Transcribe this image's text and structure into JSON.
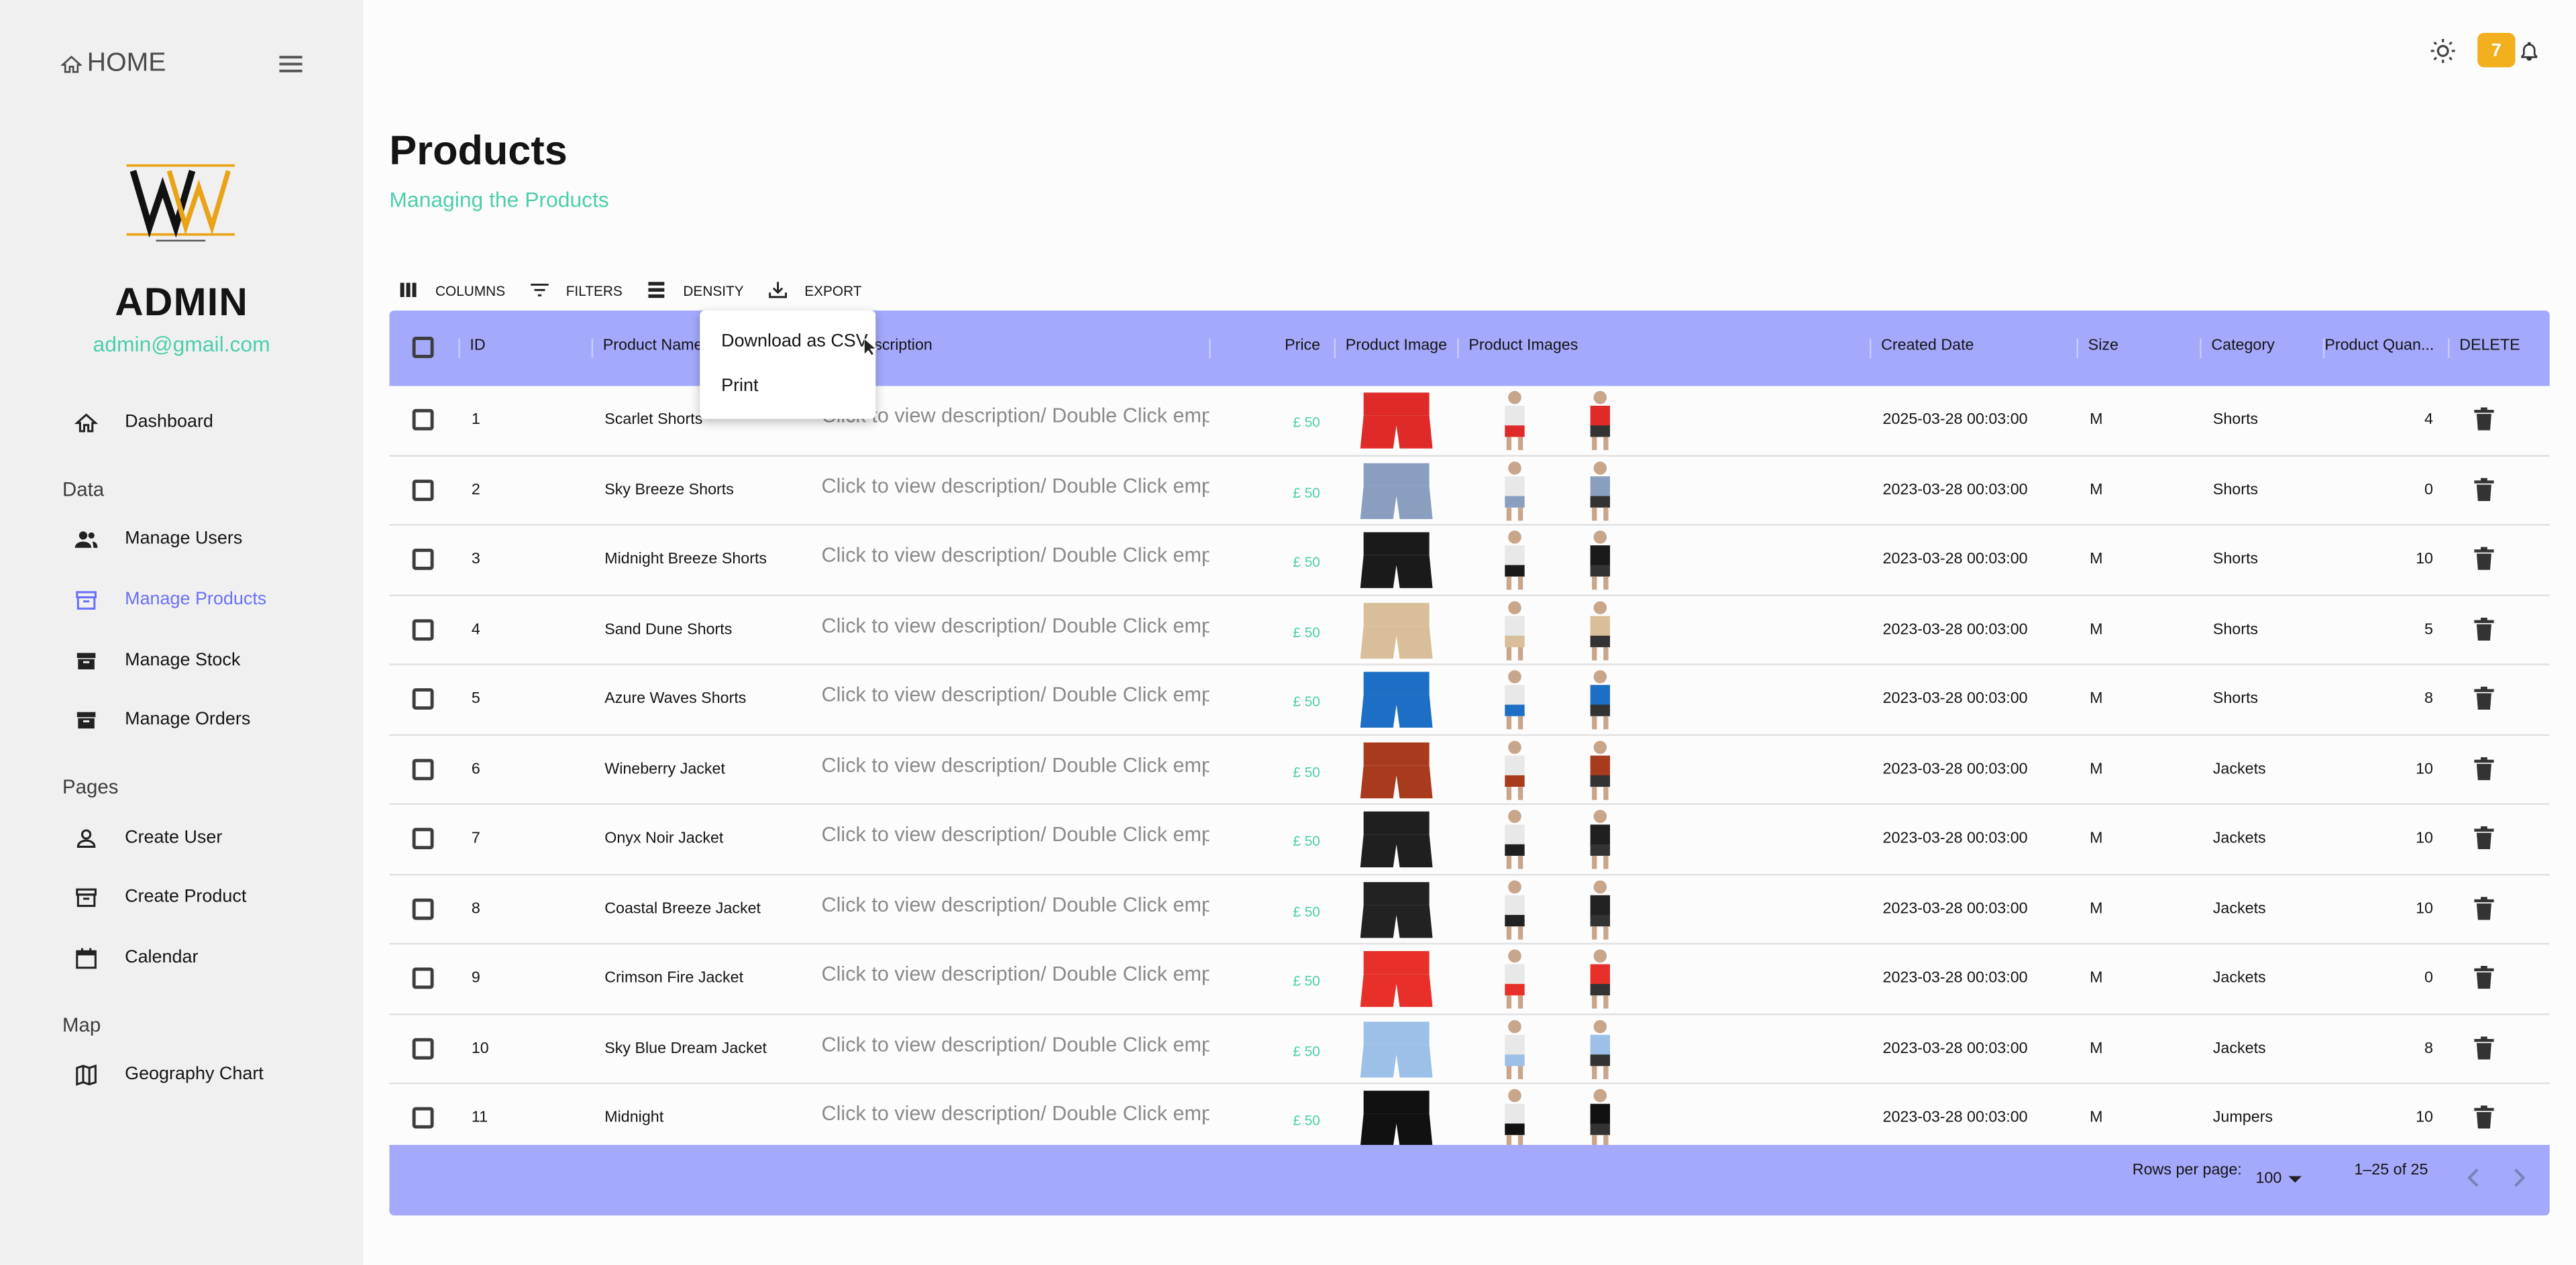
{
  "sidebar": {
    "home_label": "HOME",
    "admin_name": "ADMIN",
    "admin_email": "admin@gmail.com",
    "sections": {
      "data": "Data",
      "pages": "Pages",
      "map": "Map"
    },
    "items": [
      {
        "label": "Dashboard",
        "icon": "home-icon"
      },
      {
        "label": "Manage Users",
        "icon": "people-icon"
      },
      {
        "label": "Manage Products",
        "icon": "archive-icon",
        "active": true
      },
      {
        "label": "Manage Stock",
        "icon": "inventory-icon"
      },
      {
        "label": "Manage Orders",
        "icon": "inventory-icon"
      },
      {
        "label": "Create User",
        "icon": "person-icon"
      },
      {
        "label": "Create Product",
        "icon": "archive-icon"
      },
      {
        "label": "Calendar",
        "icon": "calendar-icon"
      },
      {
        "label": "Geography Chart",
        "icon": "map-icon"
      }
    ]
  },
  "topbar": {
    "notification_count": "7"
  },
  "header": {
    "title": "Products",
    "subtitle": "Managing the Products"
  },
  "toolbar": {
    "columns": "COLUMNS",
    "filters": "FILTERS",
    "density": "DENSITY",
    "export": "EXPORT"
  },
  "export_menu": {
    "csv": "Download as CSV",
    "print": "Print"
  },
  "table": {
    "headers": {
      "id": "ID",
      "name": "Product Name",
      "description": "Description",
      "price": "Price",
      "image": "Product Image",
      "images": "Product Images",
      "created": "Created Date",
      "size": "Size",
      "category": "Category",
      "quantity": "Product Quan...",
      "delete": "DELETE"
    },
    "rows": [
      {
        "id": "1",
        "name": "Scarlet Shorts",
        "description": "Click to view description/ Double Click emp",
        "price": "£ 50",
        "created": "2025-03-28 00:03:00",
        "size": "M",
        "category": "Shorts",
        "quantity": "4"
      },
      {
        "id": "2",
        "name": "Sky Breeze Shorts",
        "description": "Click to view description/ Double Click emp",
        "price": "£ 50",
        "created": "2023-03-28 00:03:00",
        "size": "M",
        "category": "Shorts",
        "quantity": "0"
      },
      {
        "id": "3",
        "name": "Midnight Breeze Shorts",
        "description": "Click to view description/ Double Click emp",
        "price": "£ 50",
        "created": "2023-03-28 00:03:00",
        "size": "M",
        "category": "Shorts",
        "quantity": "10"
      },
      {
        "id": "4",
        "name": "Sand Dune Shorts",
        "description": "Click to view description/ Double Click emp",
        "price": "£ 50",
        "created": "2023-03-28 00:03:00",
        "size": "M",
        "category": "Shorts",
        "quantity": "5"
      },
      {
        "id": "5",
        "name": "Azure Waves Shorts",
        "description": "Click to view description/ Double Click emp",
        "price": "£ 50",
        "created": "2023-03-28 00:03:00",
        "size": "M",
        "category": "Shorts",
        "quantity": "8"
      },
      {
        "id": "6",
        "name": "Wineberry Jacket",
        "description": "Click to view description/ Double Click emp",
        "price": "£ 50",
        "created": "2023-03-28 00:03:00",
        "size": "M",
        "category": "Jackets",
        "quantity": "10"
      },
      {
        "id": "7",
        "name": "Onyx Noir Jacket",
        "description": "Click to view description/ Double Click emp",
        "price": "£ 50",
        "created": "2023-03-28 00:03:00",
        "size": "M",
        "category": "Jackets",
        "quantity": "10"
      },
      {
        "id": "8",
        "name": "Coastal Breeze Jacket",
        "description": "Click to view description/ Double Click emp",
        "price": "£ 50",
        "created": "2023-03-28 00:03:00",
        "size": "M",
        "category": "Jackets",
        "quantity": "10"
      },
      {
        "id": "9",
        "name": "Crimson Fire Jacket",
        "description": "Click to view description/ Double Click emp",
        "price": "£ 50",
        "created": "2023-03-28 00:03:00",
        "size": "M",
        "category": "Jackets",
        "quantity": "0"
      },
      {
        "id": "10",
        "name": "Sky Blue Dream Jacket",
        "description": "Click to view description/ Double Click emp",
        "price": "£ 50",
        "created": "2023-03-28 00:03:00",
        "size": "M",
        "category": "Jackets",
        "quantity": "8"
      },
      {
        "id": "11",
        "name": "Midnight",
        "description": "Click to view description/ Double Click emp",
        "price": "£ 50",
        "created": "2023-03-28 00:03:00",
        "size": "M",
        "category": "Jumpers",
        "quantity": "10"
      }
    ],
    "product_colors": [
      "#e02a2a",
      "#8a9fc0",
      "#1a1a1a",
      "#d8bf9a",
      "#1c6fc4",
      "#a83a1e",
      "#1f1f1f",
      "#222222",
      "#e8302a",
      "#9cc0e8",
      "#111111"
    ]
  },
  "footer": {
    "rows_per_page_label": "Rows per page:",
    "rows_per_page_value": "100",
    "range": "1–25 of 25"
  },
  "colors": {
    "accent": "#6870fa",
    "header_bg": "#a4a9fc",
    "green": "#4cceac",
    "badge": "#f2b01e"
  }
}
